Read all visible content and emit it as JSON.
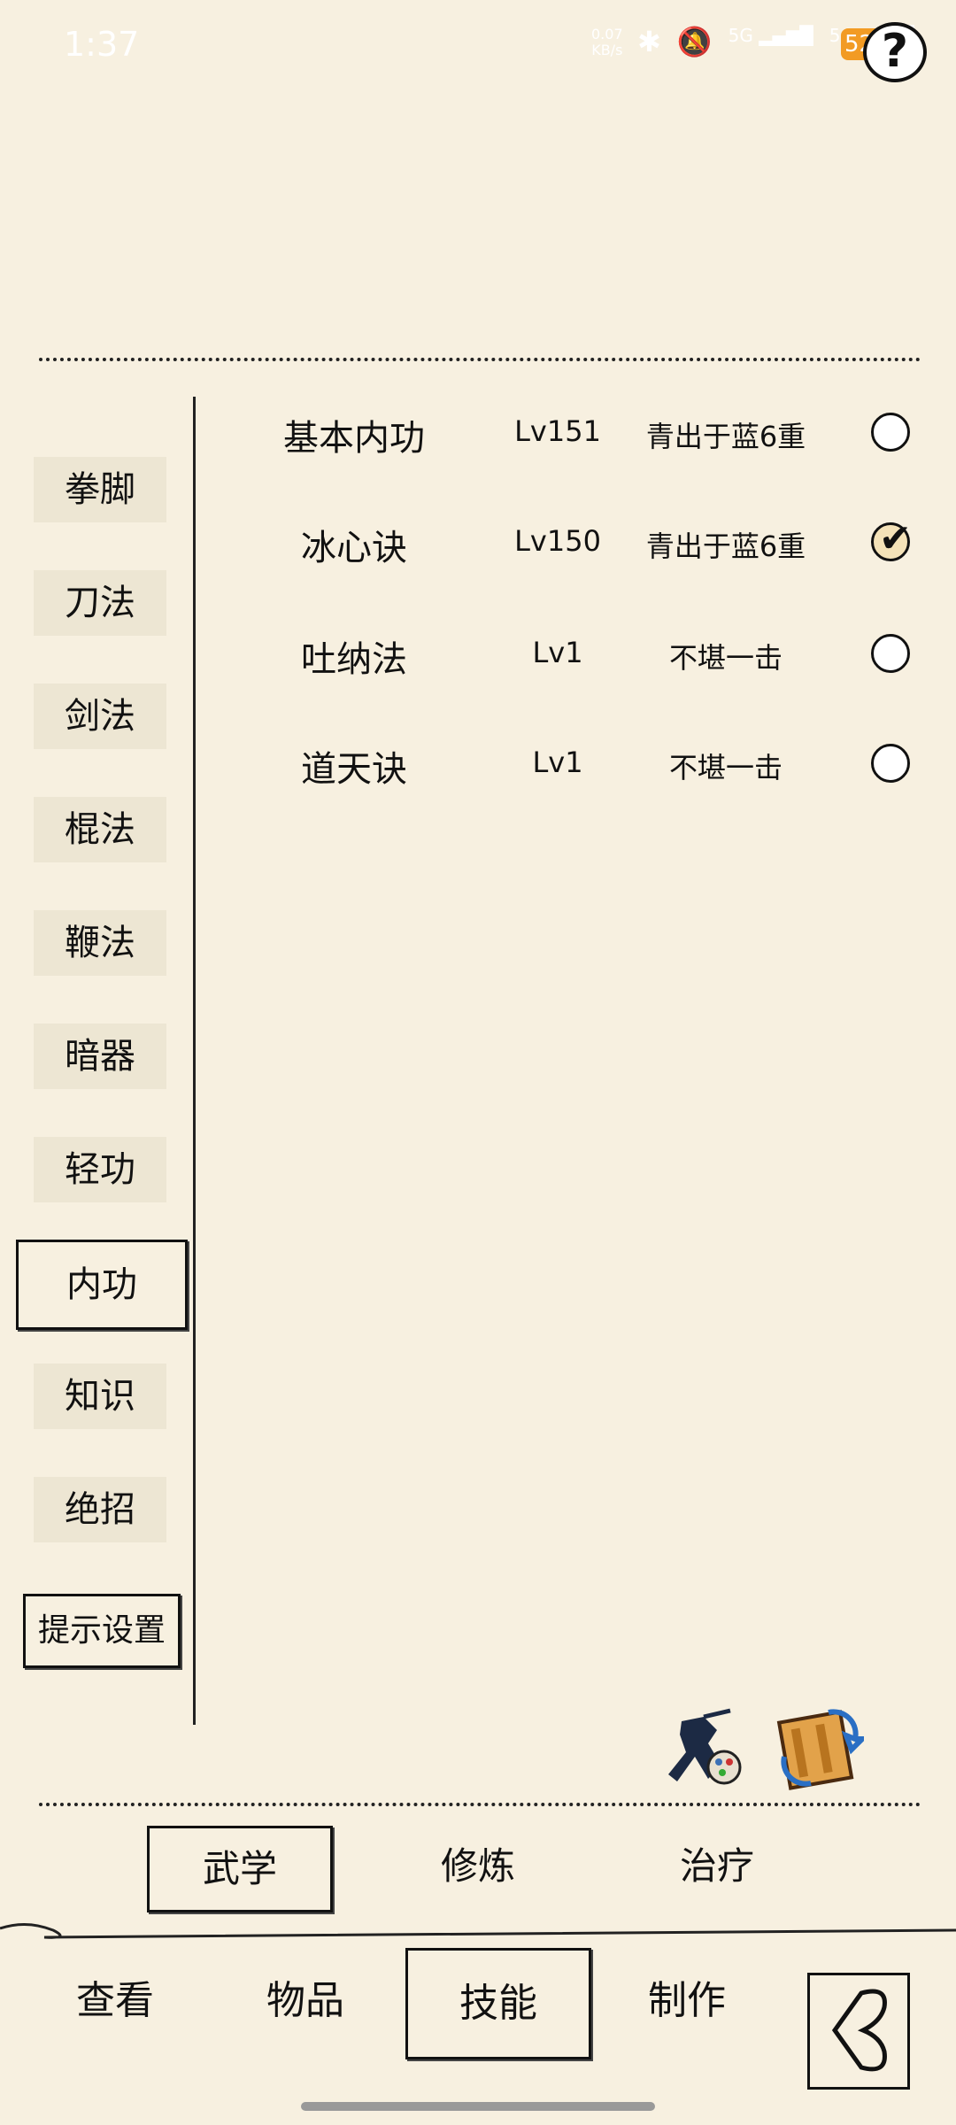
{
  "status_bar": {
    "time": "1:37",
    "net_speed_value": "0.07",
    "net_speed_unit": "KB/s",
    "signal1": "5G",
    "signal2": "5G",
    "battery": "52"
  },
  "help_button": {
    "label": "?"
  },
  "sidebar": {
    "items": [
      {
        "label": "拳脚"
      },
      {
        "label": "刀法"
      },
      {
        "label": "剑法"
      },
      {
        "label": "棍法"
      },
      {
        "label": "鞭法"
      },
      {
        "label": "暗器"
      },
      {
        "label": "轻功"
      },
      {
        "label": "内功"
      },
      {
        "label": "知识"
      },
      {
        "label": "绝招"
      }
    ],
    "active": "内功",
    "hint_settings": "提示设置"
  },
  "skills": [
    {
      "name": "基本内功",
      "level": "Lv151",
      "rank": "青出于蓝6重",
      "selected": false
    },
    {
      "name": "冰心诀",
      "level": "Lv150",
      "rank": "青出于蓝6重",
      "selected": true
    },
    {
      "name": "吐纳法",
      "level": "Lv1",
      "rank": "不堪一击",
      "selected": false
    },
    {
      "name": "道天诀",
      "level": "Lv1",
      "rank": "不堪一击",
      "selected": false
    }
  ],
  "sub_tabs": [
    {
      "label": "武学"
    },
    {
      "label": "修炼"
    },
    {
      "label": "治疗"
    }
  ],
  "nav_tabs": [
    {
      "label": "查看"
    },
    {
      "label": "物品"
    },
    {
      "label": "技能"
    },
    {
      "label": "制作"
    }
  ],
  "colors": {
    "background": "#f7f0e0",
    "ink": "#111111",
    "battery": "#f29b24"
  }
}
